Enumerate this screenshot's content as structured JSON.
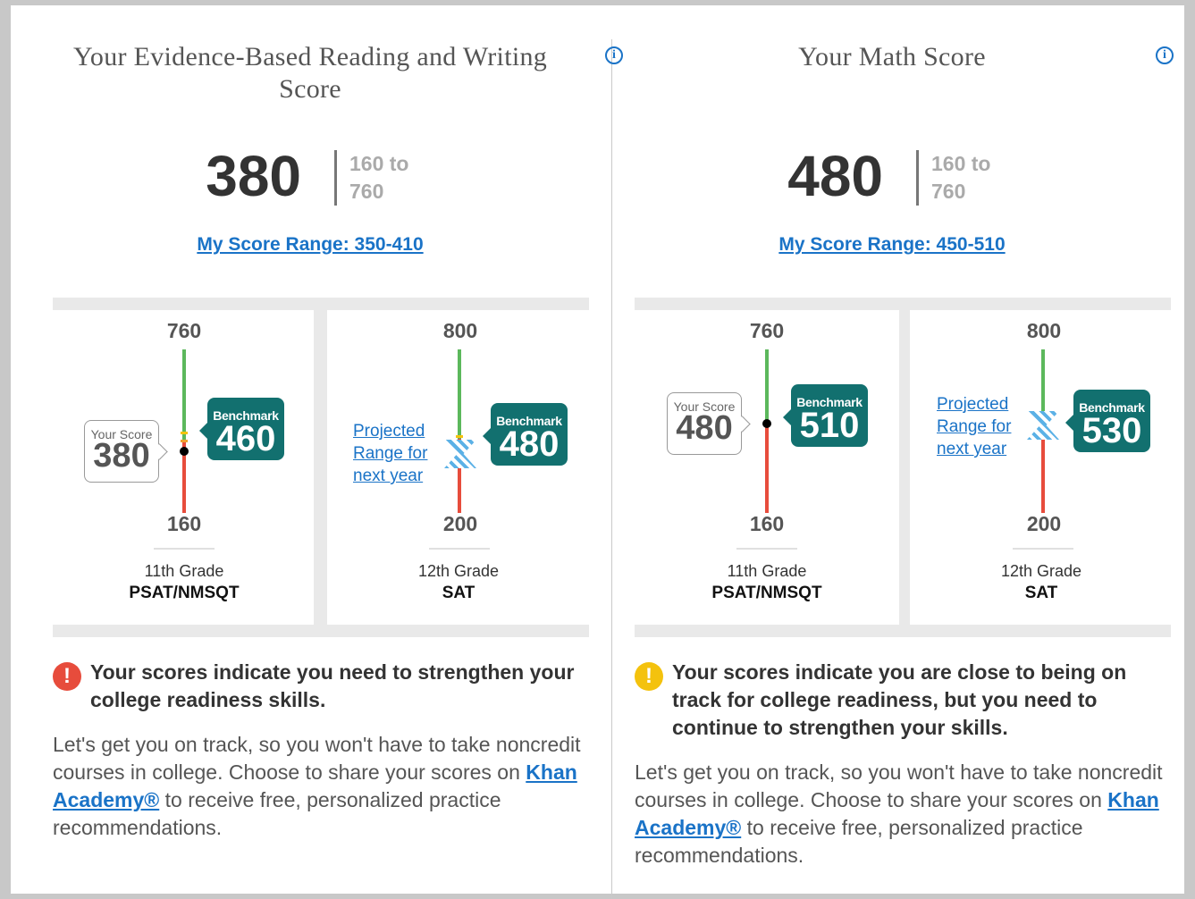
{
  "ebrw": {
    "title": "Your Evidence-Based Reading and Writing Score",
    "score": "380",
    "range_line1": "160 to",
    "range_line2": "760",
    "my_range": "My Score Range: 350-410",
    "psat": {
      "max": "760",
      "min": "160",
      "your_score_label": "Your Score",
      "your_score": "380",
      "benchmark_label": "Benchmark",
      "benchmark": "460",
      "grade": "11th Grade",
      "test": "PSAT/NMSQT"
    },
    "sat": {
      "max": "800",
      "min": "200",
      "projected_label": "Projected Range for next year",
      "benchmark_label": "Benchmark",
      "benchmark": "480",
      "grade": "12th Grade",
      "test": "SAT"
    },
    "alert": {
      "status": "error",
      "title": "Your scores indicate you need to strengthen your college readiness skills.",
      "body_before": "Let's get you on track, so you won't have to take noncredit courses in college. Choose to share your scores on ",
      "link": "Khan Academy®",
      "body_after": " to receive free, personalized practice recommendations."
    }
  },
  "math": {
    "title": "Your Math Score",
    "score": "480",
    "range_line1": "160 to",
    "range_line2": "760",
    "my_range": "My Score Range: 450-510",
    "psat": {
      "max": "760",
      "min": "160",
      "your_score_label": "Your Score",
      "your_score": "480",
      "benchmark_label": "Benchmark",
      "benchmark": "510",
      "grade": "11th Grade",
      "test": "PSAT/NMSQT"
    },
    "sat": {
      "max": "800",
      "min": "200",
      "projected_label": "Projected Range for next year",
      "benchmark_label": "Benchmark",
      "benchmark": "530",
      "grade": "12th Grade",
      "test": "SAT"
    },
    "alert": {
      "status": "warning",
      "title": "Your scores indicate you are close to being on track for college readiness, but you need to continue to strengthen your skills.",
      "body_before": "Let's get you on track, so you won't have to take noncredit courses in college. Choose to share your scores on ",
      "link": "Khan Academy®",
      "body_after": " to receive free, personalized practice recommendations."
    }
  },
  "icons": {
    "info": "info-icon",
    "error": "exclamation-icon",
    "warning": "exclamation-icon"
  },
  "colors": {
    "link": "#1a73c7",
    "benchmark": "#12706f",
    "above": "#5cb85c",
    "below": "#e74c3c",
    "error": "#e74c3c",
    "warning": "#f4c20d"
  }
}
